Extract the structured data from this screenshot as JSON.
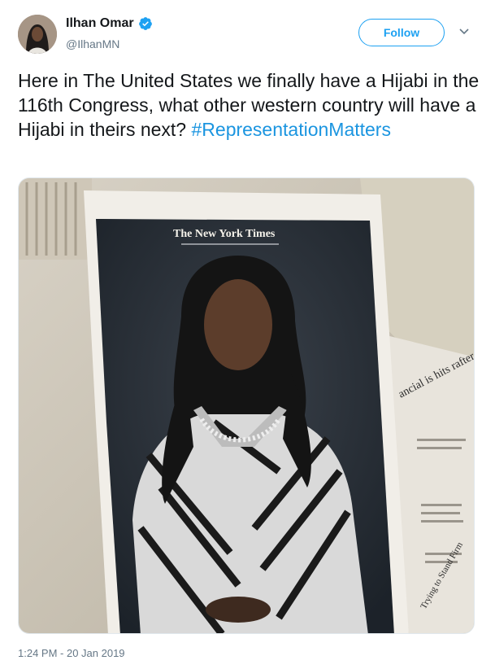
{
  "user": {
    "name": "Ilhan Omar",
    "handle": "@IlhanMN",
    "verified": true
  },
  "follow_button": {
    "label": "Follow"
  },
  "tweet": {
    "text_main": "Here in The United States we finally have a Hijabi in the 116th Congress, what other western country will have a Hijabi in theirs next? ",
    "hashtag": "#RepresentationMatters"
  },
  "media": {
    "newspaper_masthead": "The New York Times",
    "side_headline": "ancial is hits rafter nove",
    "side_footer": "Trying to Stand Firm"
  },
  "timestamp": "1:24 PM - 20 Jan 2019",
  "colors": {
    "accent": "#1da1f2",
    "hashtag": "#1b95e0",
    "muted": "#657786"
  },
  "icons": [
    "verified-badge-icon",
    "chevron-down-icon"
  ]
}
